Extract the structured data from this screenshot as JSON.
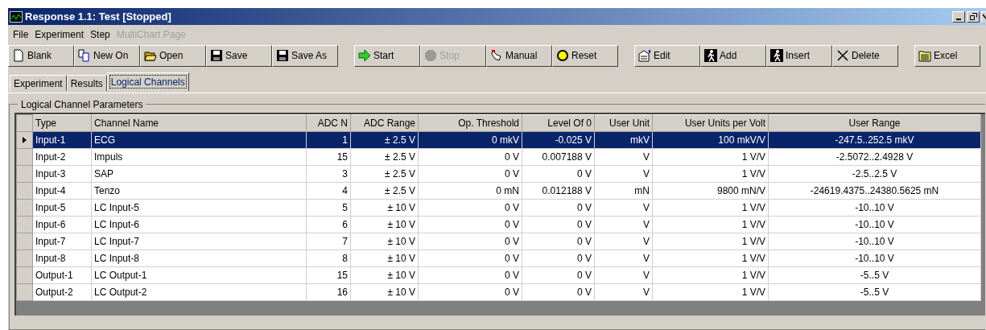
{
  "window": {
    "title": "Response 1.1: Test [Stopped]"
  },
  "menu": [
    {
      "label": "File",
      "disabled": false
    },
    {
      "label": "Experiment",
      "disabled": false
    },
    {
      "label": "Step",
      "disabled": false
    },
    {
      "label": "MultiChart Page",
      "disabled": true
    }
  ],
  "toolbar": [
    [
      {
        "label": "Blank",
        "disabled": false
      },
      {
        "label": "New On",
        "disabled": false
      },
      {
        "label": "Open",
        "disabled": false
      },
      {
        "label": "Save",
        "disabled": false
      },
      {
        "label": "Save As",
        "disabled": false
      }
    ],
    [
      {
        "label": "Start",
        "disabled": false
      },
      {
        "label": "Stop",
        "disabled": true
      },
      {
        "label": "Manual",
        "disabled": false
      },
      {
        "label": "Reset",
        "disabled": false
      }
    ],
    [
      {
        "label": "Edit",
        "disabled": false
      },
      {
        "label": "Add",
        "disabled": false
      },
      {
        "label": "Insert",
        "disabled": false
      },
      {
        "label": "Delete",
        "disabled": false
      }
    ],
    [
      {
        "label": "Excel",
        "disabled": false
      }
    ]
  ],
  "tabs": [
    {
      "label": "Experiment",
      "selected": false
    },
    {
      "label": "Results",
      "selected": false
    },
    {
      "label": "Logical Channels",
      "selected": true
    }
  ],
  "group": {
    "title": "Logical Channel Parameters"
  },
  "table": {
    "columns": [
      "Type",
      "Channel Name",
      "ADC N",
      "ADC Range",
      "Op. Threshold",
      "Level Of 0",
      "User Unit",
      "User Units per Volt",
      "User Range"
    ],
    "rows": [
      {
        "selected": true,
        "cells": [
          "Input-1",
          "ECG",
          "1",
          "± 2.5 V",
          "0 mkV",
          "-0.025 V",
          "mkV",
          "100 mkV/V",
          "-247.5..252.5 mkV"
        ]
      },
      {
        "selected": false,
        "cells": [
          "Input-2",
          "Impuls",
          "15",
          "± 2.5 V",
          "0 V",
          "0.007188 V",
          "V",
          "1 V/V",
          "-2.5072..2.4928 V"
        ]
      },
      {
        "selected": false,
        "cells": [
          "Input-3",
          "SAP",
          "3",
          "± 2.5 V",
          "0 V",
          "0 V",
          "V",
          "1 V/V",
          "-2.5..2.5 V"
        ]
      },
      {
        "selected": false,
        "cells": [
          "Input-4",
          "Tenzo",
          "4",
          "± 2.5 V",
          "0 mN",
          "0.012188 V",
          "mN",
          "9800 mN/V",
          "-24619.4375..24380.5625 mN"
        ]
      },
      {
        "selected": false,
        "cells": [
          "Input-5",
          "LC Input-5",
          "5",
          "± 10 V",
          "0 V",
          "0 V",
          "V",
          "1 V/V",
          "-10..10 V"
        ]
      },
      {
        "selected": false,
        "cells": [
          "Input-6",
          "LC Input-6",
          "6",
          "± 10 V",
          "0 V",
          "0 V",
          "V",
          "1 V/V",
          "-10..10 V"
        ]
      },
      {
        "selected": false,
        "cells": [
          "Input-7",
          "LC Input-7",
          "7",
          "± 10 V",
          "0 V",
          "0 V",
          "V",
          "1 V/V",
          "-10..10 V"
        ]
      },
      {
        "selected": false,
        "cells": [
          "Input-8",
          "LC Input-8",
          "8",
          "± 10 V",
          "0 V",
          "0 V",
          "V",
          "1 V/V",
          "-10..10 V"
        ]
      },
      {
        "selected": false,
        "cells": [
          "Output-1",
          "LC Output-1",
          "15",
          "± 10 V",
          "0 V",
          "0 V",
          "V",
          "1 V/V",
          "-5..5 V"
        ]
      },
      {
        "selected": false,
        "cells": [
          "Output-2",
          "LC Output-2",
          "16",
          "± 10 V",
          "0 V",
          "0 V",
          "V",
          "1 V/V",
          "-5..5 V"
        ]
      }
    ]
  }
}
